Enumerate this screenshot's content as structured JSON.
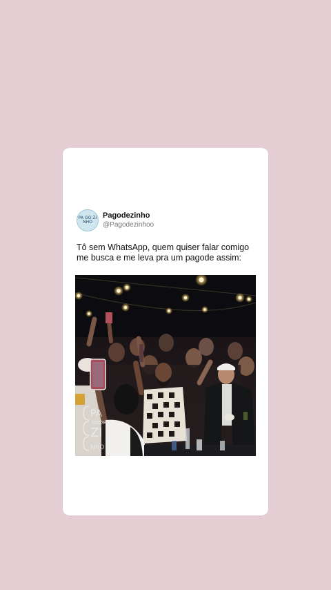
{
  "post": {
    "author_name": "Pagodezinho",
    "author_handle": "@Pagodezinhoo",
    "avatar_text": "PA GO ZI NHO",
    "text": "Tô sem WhatsApp, quem quiser falar comigo me busca e me leva pra um pagode assim:"
  },
  "media": {
    "description_icon": "photo-image",
    "watermark_lines": [
      "PA",
      "GODE",
      "ZI",
      "NHO"
    ]
  },
  "colors": {
    "background": "#e5cdd4",
    "card": "#ffffff"
  }
}
